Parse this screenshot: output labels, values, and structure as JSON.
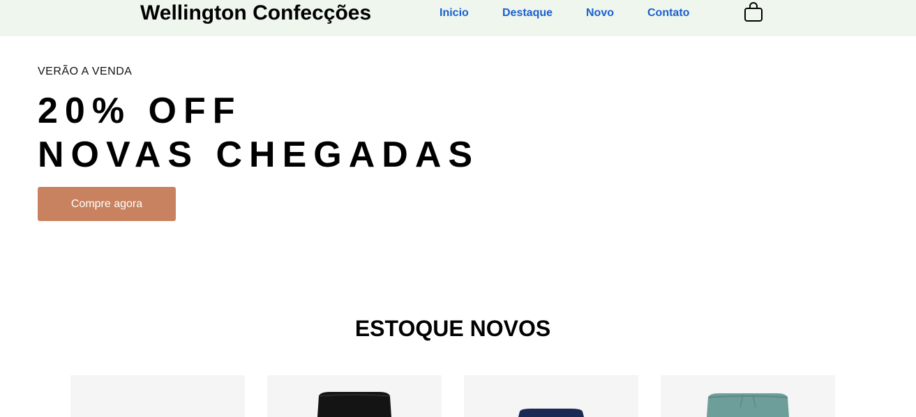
{
  "header": {
    "brand": "Wellington Confecções",
    "nav": [
      {
        "label": "Inicio"
      },
      {
        "label": "Destaque"
      },
      {
        "label": "Novo"
      },
      {
        "label": "Contato"
      }
    ],
    "cart_icon": "shopping-bag-icon"
  },
  "hero": {
    "kicker": "VERÃO A VENDA",
    "line1": "20% OFF",
    "line2": "NOVAS CHEGADAS",
    "cta_label": "Compre agora"
  },
  "products_section": {
    "title": "ESTOQUE NOVOS",
    "products": [
      {
        "image": "empty",
        "color": "#f5f5f5"
      },
      {
        "image": "black-shorts",
        "color": "#141414"
      },
      {
        "image": "navy-shorts",
        "color": "#1b2a55"
      },
      {
        "image": "teal-shorts",
        "color": "#6e9e9a"
      }
    ]
  },
  "colors": {
    "header_bg": "#eef6ee",
    "nav_link": "#1a5fd1",
    "cta_bg": "#c8825f",
    "card_bg": "#f5f5f5"
  }
}
